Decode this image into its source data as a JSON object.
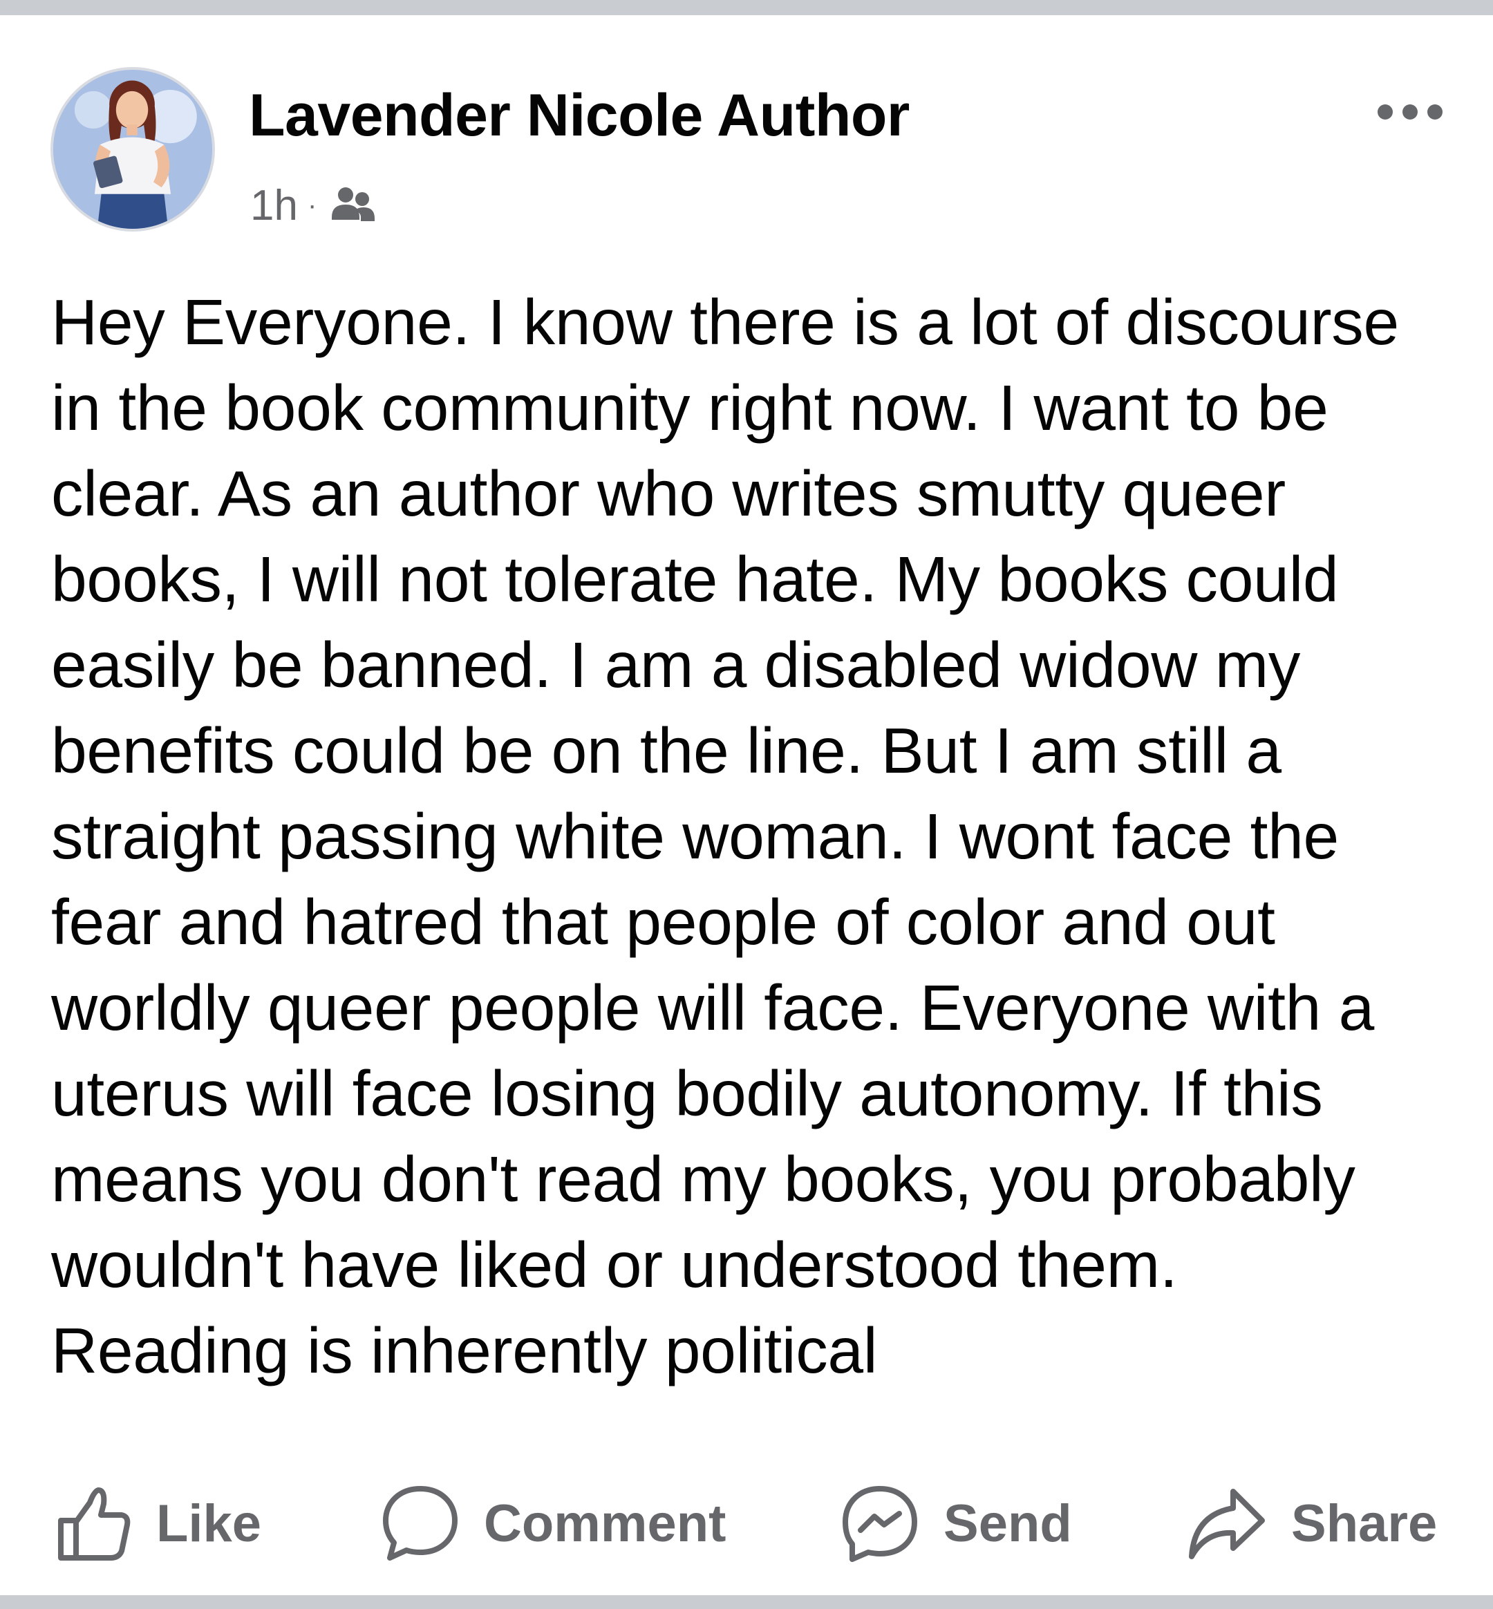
{
  "post": {
    "author_name": "Lavender Nicole Author",
    "timestamp": "1h",
    "separator": "·",
    "audience_icon": "friends-icon",
    "more_icon": "more-options-icon",
    "body": "Hey Everyone. I know there is a lot of discourse\nin the book community right now. I want to be\nclear. As an author who writes smutty queer\nbooks, I will not tolerate hate. My books could\neasily be banned. I am a disabled widow my\nbenefits could be on the line. But I am still a\nstraight passing white woman. I wont face the\nfear and hatred that people of color and out\nworldly queer people will face. Everyone with a\nuterus will face losing bodily autonomy. If this\nmeans you don't read my books, you probably\nwouldn't have liked or understood them.\nReading is inherently political"
  },
  "actions": {
    "like_label": "Like",
    "comment_label": "Comment",
    "send_label": "Send",
    "share_label": "Share"
  },
  "colors": {
    "text_primary": "#050505",
    "text_secondary": "#65676b",
    "background": "#ffffff",
    "frame": "#c9ccd1"
  }
}
